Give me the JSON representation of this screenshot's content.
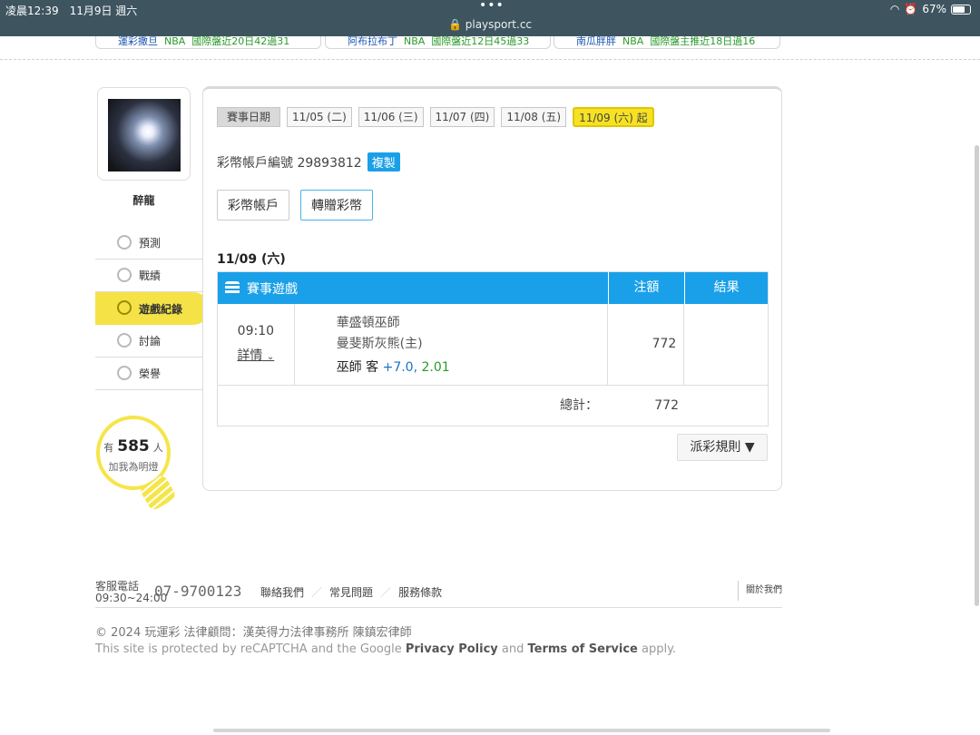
{
  "statusbar": {
    "time": "凌晨12:39　11月9日 週六",
    "url": "playsport.cc",
    "battery": "67%"
  },
  "ticker": [
    {
      "user": "運彩撒旦",
      "league": "NBA",
      "text": "國際盤近20日42過31"
    },
    {
      "user": "阿布拉布丁",
      "league": "NBA",
      "text": "國際盤近12日45過33"
    },
    {
      "user": "南瓜胖胖",
      "league": "NBA",
      "text": "國際盤主推近18日過16"
    }
  ],
  "profile": {
    "name": "醉龍",
    "menu": [
      "預測",
      "戰績",
      "遊戲紀錄",
      "討論",
      "榮譽"
    ],
    "fans_prefix": "有",
    "fans_count": "585",
    "fans_suffix": "人",
    "fans_text": "加我為明燈"
  },
  "dates": {
    "label": "賽事日期",
    "items": [
      "11/05 (二)",
      "11/06 (三)",
      "11/07 (四)",
      "11/08 (五)",
      "11/09 (六) 起"
    ]
  },
  "account": {
    "label": "彩幣帳戶編號 29893812",
    "copy": "複製"
  },
  "tabs": [
    "彩幣帳戶",
    "轉贈彩幣"
  ],
  "day_title": "11/09 (六)",
  "table": {
    "headers": [
      "賽事遊戲",
      "注額",
      "結果"
    ],
    "row": {
      "time": "09:10",
      "detail": "詳情",
      "away": "華盛頓巫師",
      "home": "曼斐斯灰熊(主)",
      "pick_team": "巫師 客",
      "pick_line": "+7.0,",
      "pick_odds": "2.01",
      "amount": "772",
      "result": ""
    },
    "total_label": "總計：",
    "total_value": "772"
  },
  "rule_button": "派彩規則 ▼",
  "footer": {
    "phone_label": "客服電話",
    "phone_hours": "09:30~24:00",
    "phone": "07-9700123",
    "links": [
      "聯絡我們",
      "常見問題",
      "服務條款"
    ],
    "about": "關於我們",
    "copyright": "© 2024 玩運彩 法律顧問：漢英得力法律事務所 陳鎮宏律師",
    "recaptcha_pre": "This site is protected by reCAPTCHA and the Google",
    "privacy": "Privacy Policy",
    "and": "and",
    "terms": "Terms of Service",
    "apply": "apply."
  }
}
